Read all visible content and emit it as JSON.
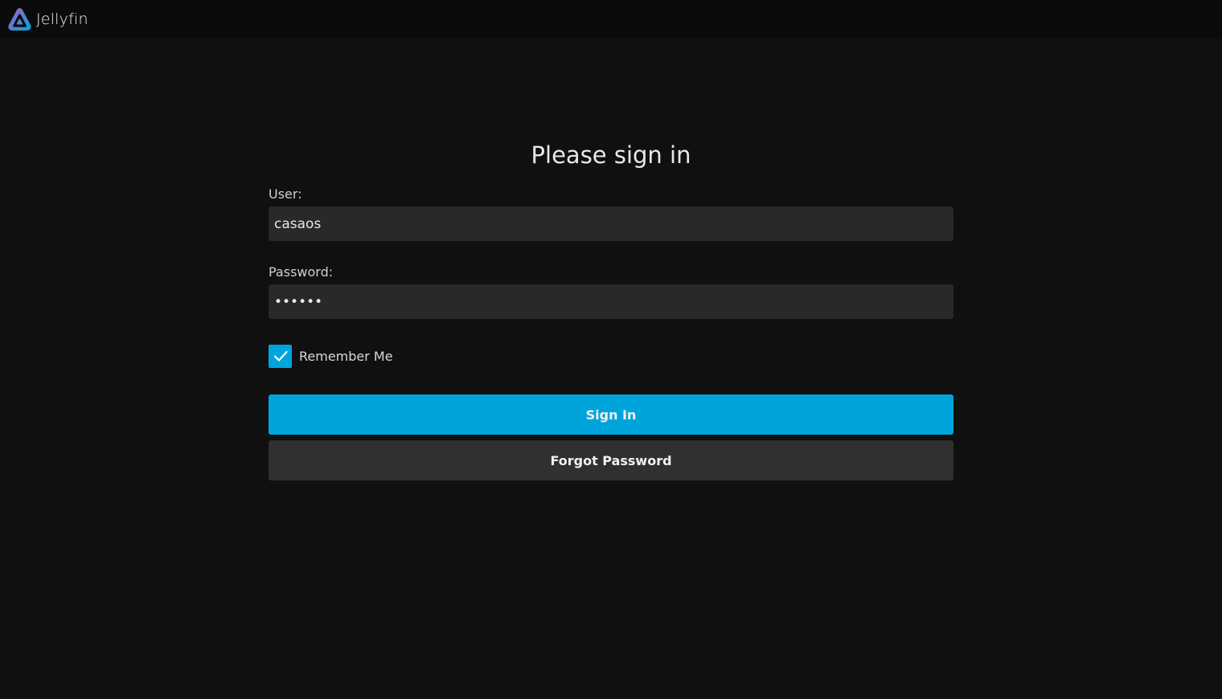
{
  "header": {
    "app_name": "Jellyfin",
    "logo_icon": "jellyfin-logo-icon"
  },
  "login": {
    "title": "Please sign in",
    "user_label": "User:",
    "user_value": "casaos",
    "password_label": "Password:",
    "password_value": "••••••",
    "remember_me_label": "Remember Me",
    "remember_me_checked": true,
    "sign_in_label": "Sign In",
    "forgot_password_label": "Forgot Password"
  },
  "colors": {
    "accent": "#00a4dc",
    "background": "#101010",
    "header_background": "#0b0b0b",
    "input_background": "#292929",
    "secondary_button": "#303030"
  }
}
